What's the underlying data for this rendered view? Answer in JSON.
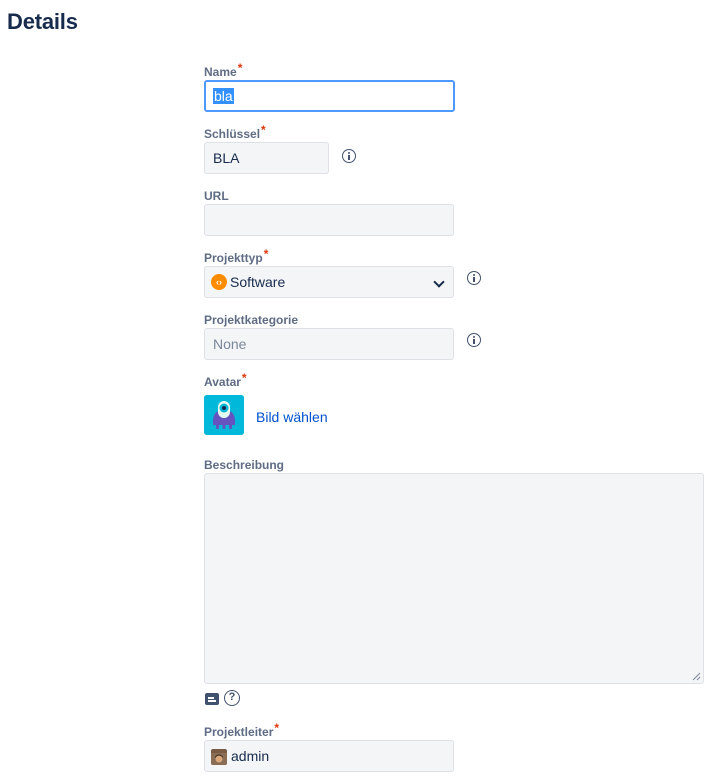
{
  "page": {
    "title": "Details"
  },
  "form": {
    "name": {
      "label": "Name",
      "required": "*",
      "value": "bla"
    },
    "key": {
      "label": "Schlüssel",
      "required": "*",
      "value": "BLA"
    },
    "url": {
      "label": "URL",
      "value": ""
    },
    "project_type": {
      "label": "Projekttyp",
      "required": "*",
      "value": "Software",
      "icon": "software-project-icon"
    },
    "project_category": {
      "label": "Projektkategorie",
      "placeholder": "None"
    },
    "avatar": {
      "label": "Avatar",
      "required": "*",
      "link": "Bild wählen",
      "icon": "project-avatar-icon"
    },
    "description": {
      "label": "Beschreibung",
      "value": ""
    },
    "project_lead": {
      "label": "Projektleiter",
      "required": "*",
      "value": "admin",
      "icon": "user-avatar-icon"
    }
  },
  "colors": {
    "accent": "#4c9aff",
    "link": "#0052cc",
    "required": "#de350b",
    "avatar_bg": "#00b8d9",
    "software_icon": "#ff8b00"
  }
}
